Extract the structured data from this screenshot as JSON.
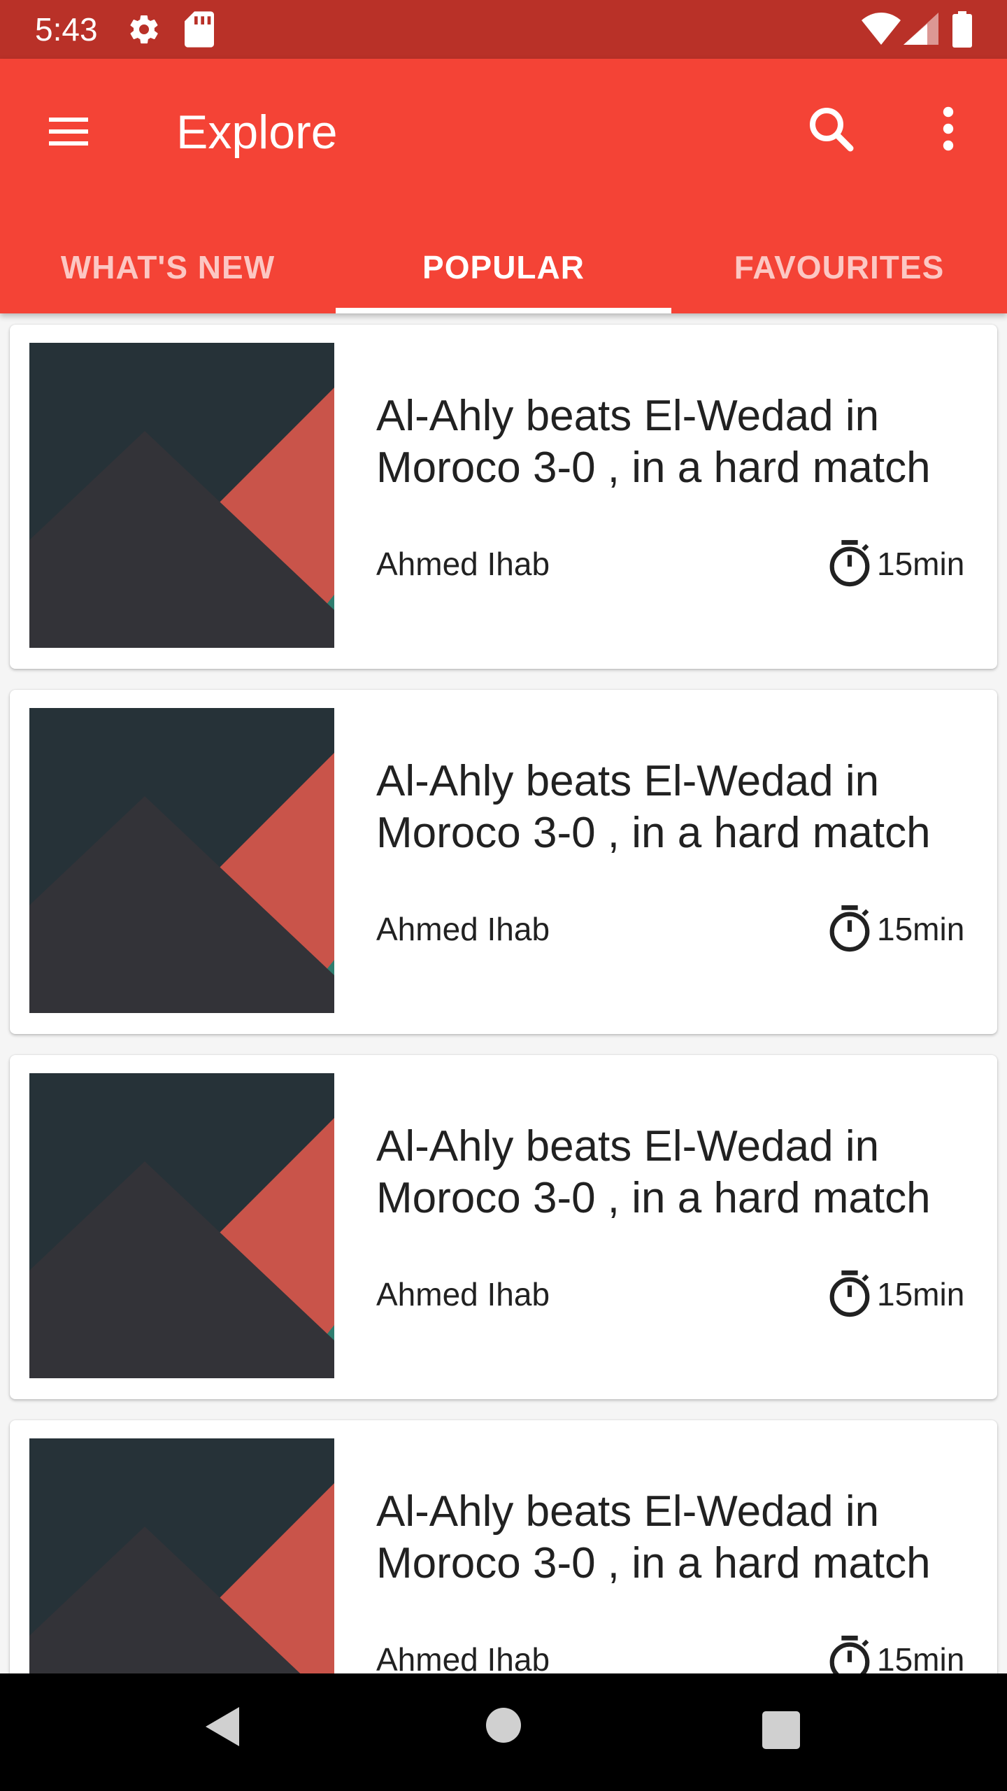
{
  "status_bar": {
    "time": "5:43",
    "icons": [
      "gear-icon",
      "sd-card-icon",
      "wifi-icon",
      "cell-signal-icon",
      "battery-icon"
    ]
  },
  "app_bar": {
    "title": "Explore",
    "color": "#f44336",
    "icons": [
      "menu-icon",
      "search-icon",
      "more-vert-icon"
    ]
  },
  "tabs": [
    {
      "label": "WHAT'S NEW",
      "active": false
    },
    {
      "label": "POPULAR",
      "active": true
    },
    {
      "label": "FAVOURITES",
      "active": false
    }
  ],
  "articles": [
    {
      "title": "Al-Ahly beats El-Wedad in Moroco 3-0 , in a hard match",
      "author": "Ahmed Ihab",
      "duration": "15min"
    },
    {
      "title": "Al-Ahly beats El-Wedad in Moroco 3-0 , in a hard match",
      "author": "Ahmed Ihab",
      "duration": "15min"
    },
    {
      "title": "Al-Ahly beats El-Wedad in Moroco 3-0 , in a hard match",
      "author": "Ahmed Ihab",
      "duration": "15min"
    },
    {
      "title": "Al-Ahly beats El-Wedad in Moroco 3-0 , in a hard match",
      "author": "Ahmed Ihab",
      "duration": "15min"
    }
  ],
  "nav_bar": {
    "icons": [
      "back-icon",
      "home-icon",
      "recents-icon"
    ]
  }
}
